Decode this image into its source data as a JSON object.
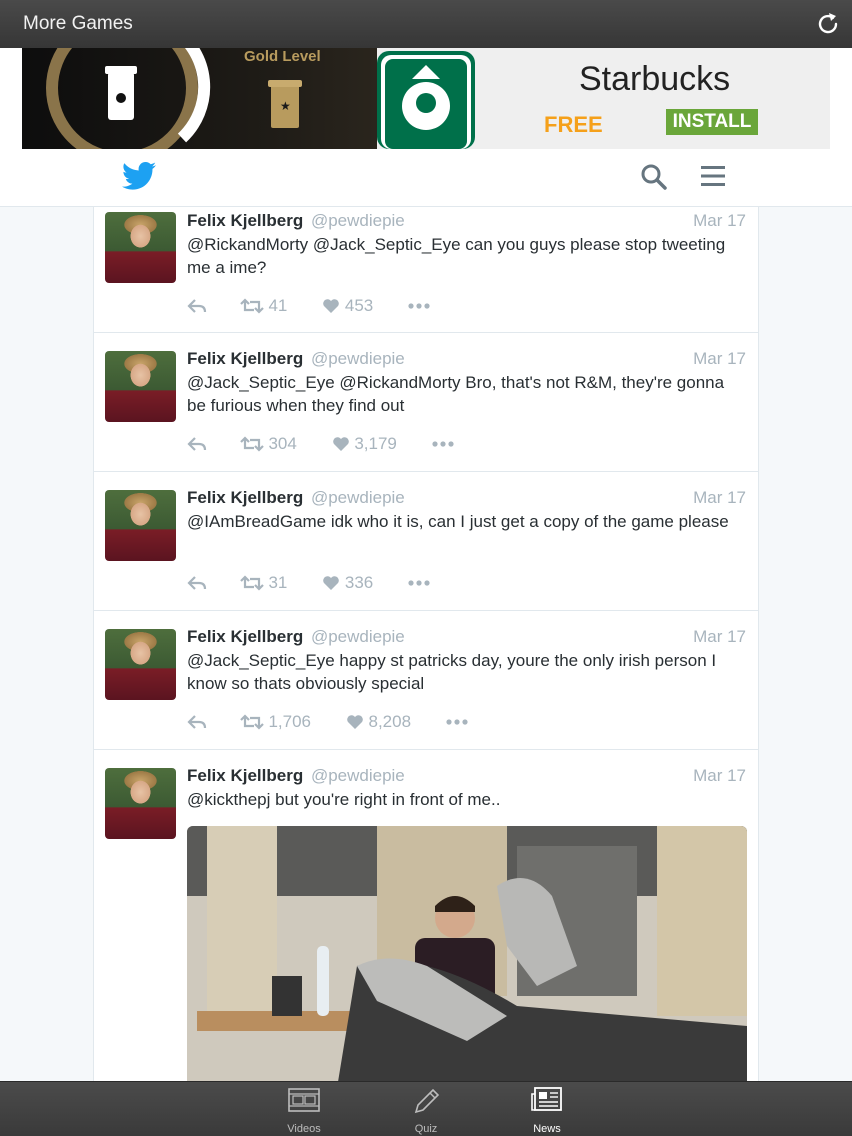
{
  "topbar": {
    "title": "More Games"
  },
  "ad": {
    "gold_label": "Gold Level",
    "brand": "Starbucks",
    "free": "FREE",
    "install": "INSTALL"
  },
  "tweets": [
    {
      "name": "Felix Kjellberg",
      "handle": "@pewdiepie",
      "date": "Mar 17",
      "text": "@RickandMorty @Jack_Septic_Eye can you guys please stop tweeting me a ime?",
      "retweets": "41",
      "likes": "453"
    },
    {
      "name": "Felix Kjellberg",
      "handle": "@pewdiepie",
      "date": "Mar 17",
      "text": "@Jack_Septic_Eye @RickandMorty Bro, that's not R&M, they're gonna be furious when they find out",
      "retweets": "304",
      "likes": "3,179"
    },
    {
      "name": "Felix Kjellberg",
      "handle": "@pewdiepie",
      "date": "Mar 17",
      "text": "@IAmBreadGame idk who it is, can I just get a copy of the game please",
      "retweets": "31",
      "likes": "336"
    },
    {
      "name": "Felix Kjellberg",
      "handle": "@pewdiepie",
      "date": "Mar 17",
      "text": "@Jack_Septic_Eye happy st patricks day, youre the only irish person I know so thats obviously special",
      "retweets": "1,706",
      "likes": "8,208"
    },
    {
      "name": "Felix Kjellberg",
      "handle": "@pewdiepie",
      "date": "Mar 17",
      "text": "@kickthepj but you're right in front of me.."
    }
  ],
  "tabs": [
    {
      "label": "Videos",
      "icon": "film-icon"
    },
    {
      "label": "Quiz",
      "icon": "pencil-icon"
    },
    {
      "label": "News",
      "icon": "newspaper-icon",
      "active": true
    }
  ],
  "colors": {
    "twitter_blue": "#1da1f2",
    "muted": "#a8b4bd",
    "starbucks_green": "#00704a"
  }
}
